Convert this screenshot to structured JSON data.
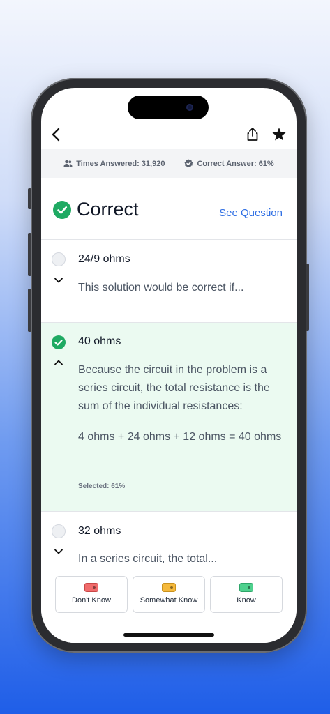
{
  "stats": {
    "times_answered": "Times Answered: 31,920",
    "correct_answer": "Correct Answer: 61%"
  },
  "result": {
    "title": "Correct",
    "see_question": "See Question"
  },
  "options": [
    {
      "title": "24/9 ohms",
      "text": "This solution would be correct if..."
    },
    {
      "title": "40 ohms",
      "text": "Because the circuit in the problem is a series circuit, the total resistance is the sum of the individual resistances:",
      "formula": "4 ohms + 24 ohms + 12 ohms = 40 ohms",
      "selected_label": "Selected: 61%"
    },
    {
      "title": "32 ohms",
      "text": "In a series circuit, the total..."
    }
  ],
  "knowledge": {
    "dont_know": "Don't Know",
    "somewhat_know": "Somewhat Know",
    "know": "Know"
  },
  "colors": {
    "accent": "#2f6fe4",
    "correct": "#1faa63",
    "selected_bg": "#ebfaf1",
    "tag_red": "#f06b6b",
    "tag_yellow": "#f5b93c",
    "tag_green": "#4fd18e"
  },
  "icons": {
    "back": "chevron-left-icon",
    "share": "share-icon",
    "star": "star-icon",
    "users": "users-icon",
    "badge": "badge-check-icon"
  }
}
